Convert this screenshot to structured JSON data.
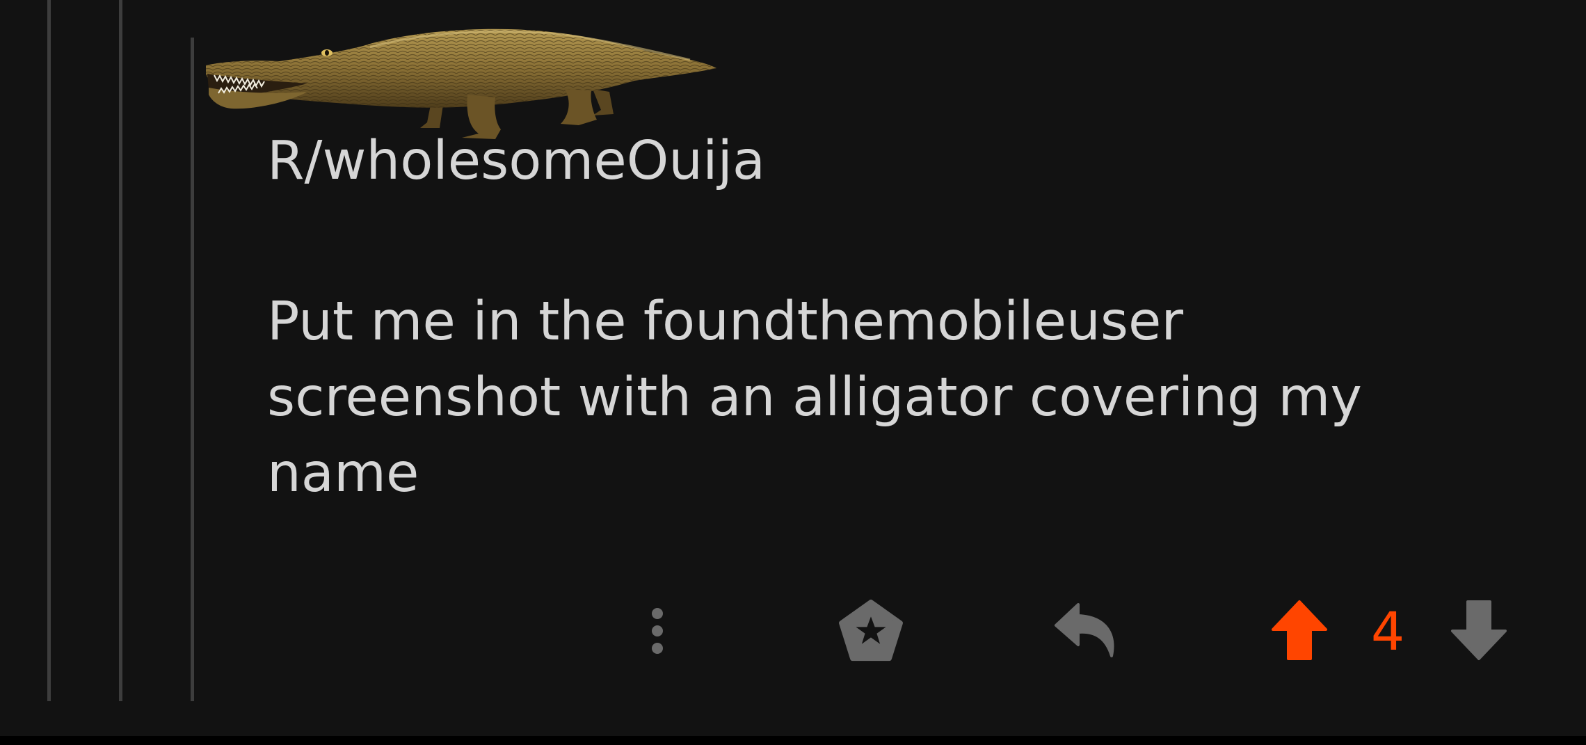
{
  "comment": {
    "subreddit": "R/wholesomeOuija",
    "body": "Put me in the foundthemobileuser screenshot with an alligator covering my name",
    "score": "4",
    "username_cover": "alligator"
  },
  "actions": {
    "more": "more-vertical-icon",
    "award": "award-icon",
    "reply": "reply-icon",
    "upvote": "upvote-arrow-icon",
    "downvote": "downvote-arrow-icon"
  },
  "colors": {
    "background": "#121212",
    "text": "#d6d6d6",
    "upvote_active": "#ff4500",
    "icon_inactive": "#6a6a6a",
    "thread_line": "#3d3d3d"
  }
}
